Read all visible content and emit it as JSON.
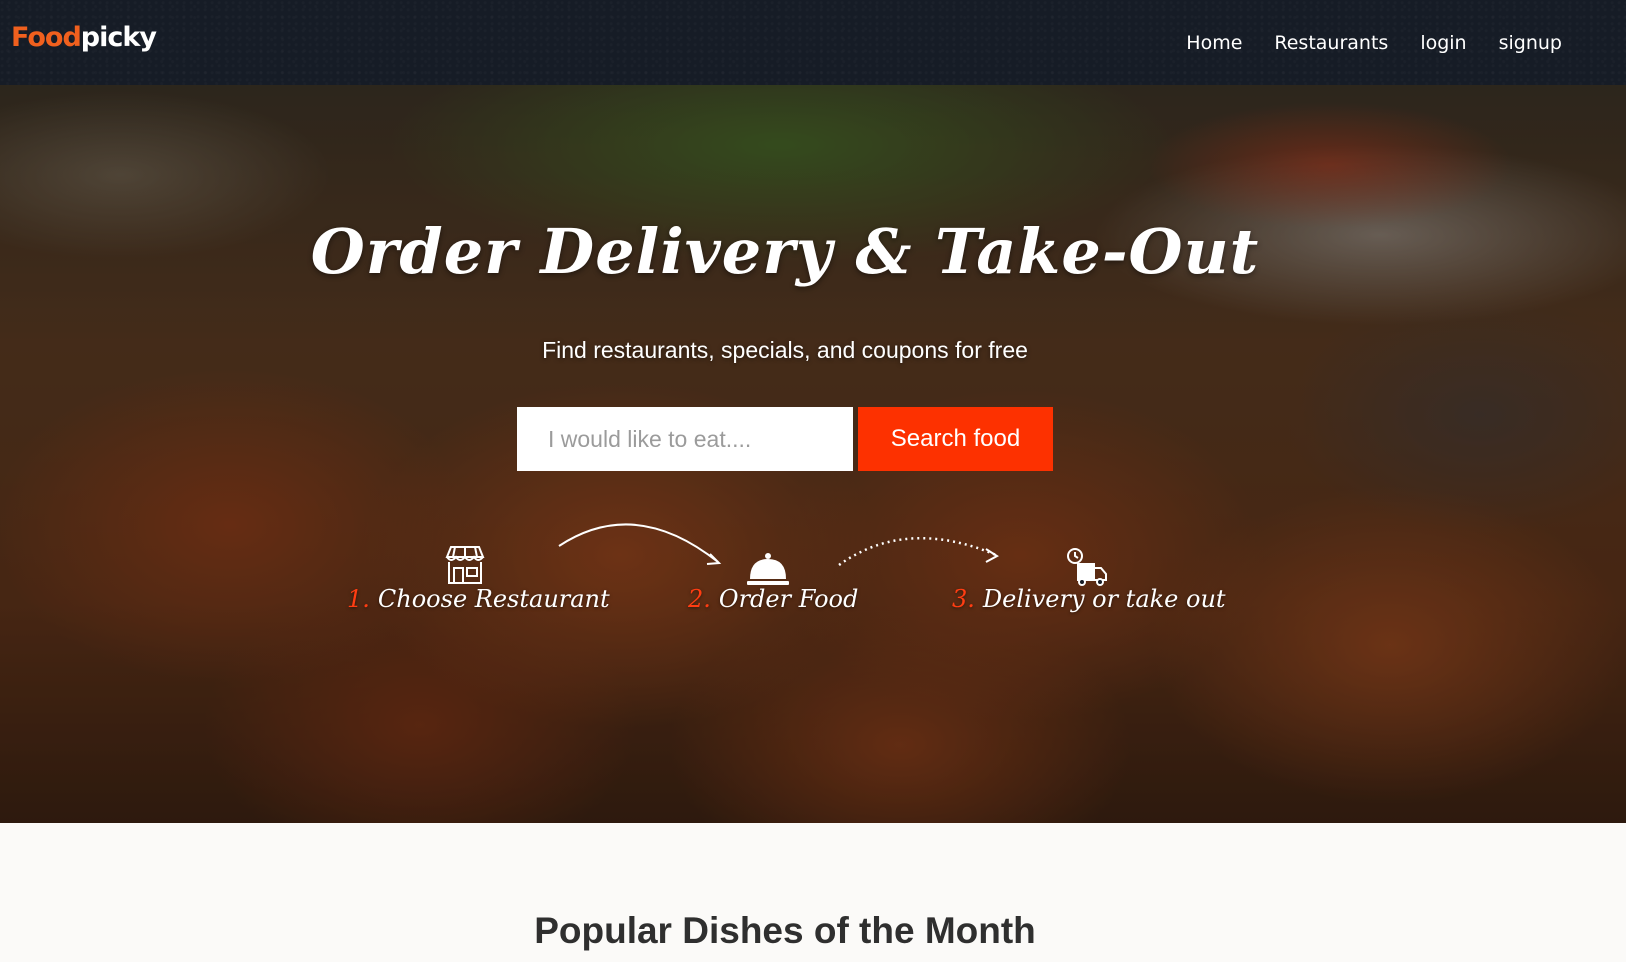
{
  "navbar": {
    "brand_part1": "Food",
    "brand_part2": "picky",
    "links": [
      "Home",
      "Restaurants",
      "login",
      "signup"
    ]
  },
  "hero": {
    "title": "Order Delivery & Take-Out",
    "subtitle": "Find restaurants, specials, and coupons for free",
    "search_placeholder": "I would like to eat....",
    "search_button": "Search food",
    "steps": [
      {
        "num": "1.",
        "label": "Choose Restaurant",
        "icon": "storefront-icon"
      },
      {
        "num": "2.",
        "label": "Order Food",
        "icon": "serving-cloche-icon"
      },
      {
        "num": "3.",
        "label": "Delivery or take out",
        "icon": "delivery-truck-icon"
      }
    ]
  },
  "popular": {
    "title": "Popular Dishes of the Month"
  },
  "colors": {
    "navbar_bg": "#161c26",
    "brand_accent": "#f0601e",
    "search_button_bg": "#fd3100",
    "step_number": "#ff3d12",
    "page_bg": "#fbfaf8"
  }
}
